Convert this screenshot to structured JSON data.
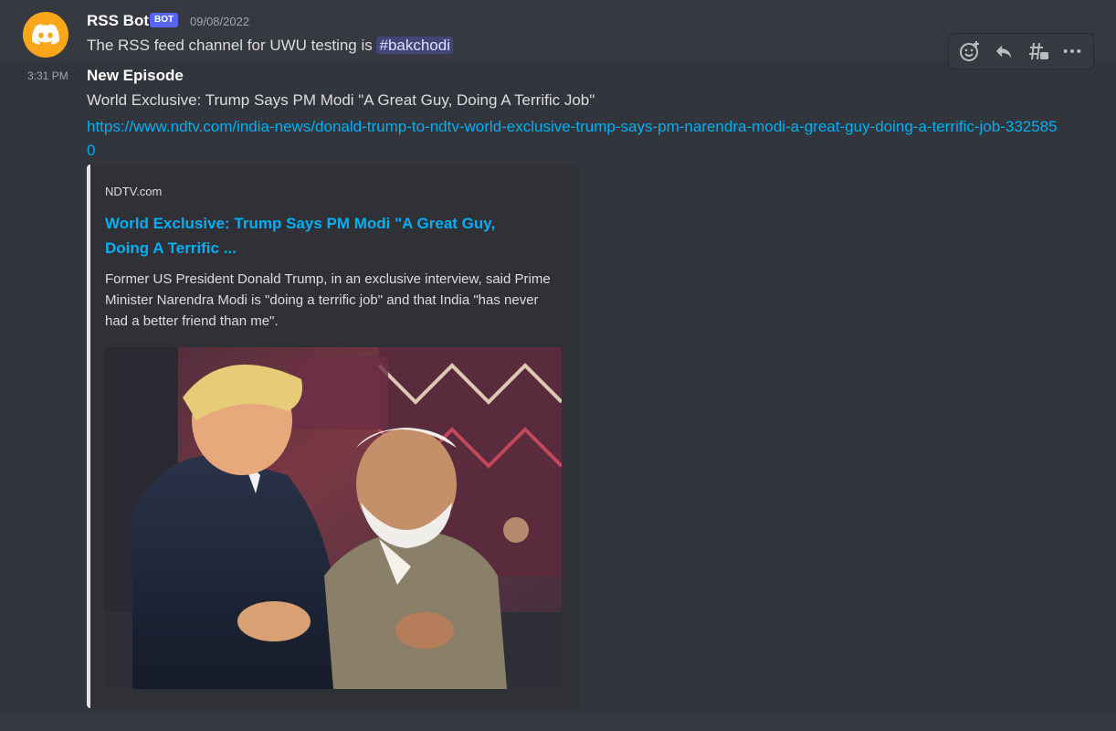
{
  "message": {
    "author": "RSS Bot",
    "bot_tag": "BOT",
    "date": "09/08/2022",
    "intro_text": "The RSS feed channel for UWU testing is ",
    "channel_name": "#bakchodi"
  },
  "followup": {
    "time": "3:31 PM",
    "title": "New Episode",
    "subtitle": "World Exclusive: Trump Says PM Modi \"A Great Guy, Doing A Terrific Job\"",
    "link": "https://www.ndtv.com/india-news/donald-trump-to-ndtv-world-exclusive-trump-says-pm-narendra-modi-a-great-guy-doing-a-terrific-job-3325850"
  },
  "embed": {
    "provider": "NDTV.com",
    "title": "World Exclusive: Trump Says PM Modi \"A Great Guy, Doing A Terrific ...",
    "description": "Former US President Donald Trump, in an exclusive interview, said Prime Minister Narendra Modi is \"doing a terrific job\" and that India \"has never had a better friend than me\".",
    "accent_color": "#e3e5e8"
  },
  "toolbar": {
    "icons": [
      "add-reaction-icon",
      "reply-icon",
      "create-thread-icon",
      "more-icon"
    ]
  },
  "colors": {
    "background": "#36393f",
    "link": "#00aff4",
    "bot_tag": "#5865f2",
    "avatar": "#faa61a"
  }
}
